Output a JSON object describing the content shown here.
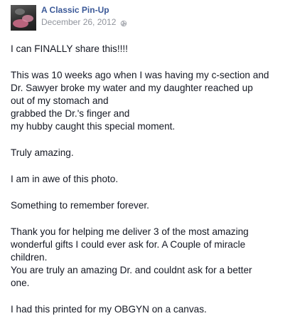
{
  "post": {
    "author": "A Classic Pin-Up",
    "date": "December 26, 2012",
    "privacy_icon": "globe-icon",
    "lines": [
      "I can FINALLY share this!!!!",
      "",
      "This was 10 weeks ago when I was having my c-section and",
      "Dr. Sawyer broke my water and my daughter reached up",
      "out of my stomach and",
      "grabbed the Dr.'s finger and",
      "my hubby caught this special moment.",
      "",
      "Truly amazing.",
      "",
      "I am in awe of this photo.",
      "",
      "Something to remember forever.",
      "",
      "Thank you for helping me deliver 3 of the most amazing",
      "wonderful gifts I could ever ask for. A Couple of miracle",
      "children.",
      "You are truly an amazing Dr. and couldnt ask for a better",
      "one.",
      "",
      "I had this printed for my OBGYN on a canvas."
    ]
  }
}
